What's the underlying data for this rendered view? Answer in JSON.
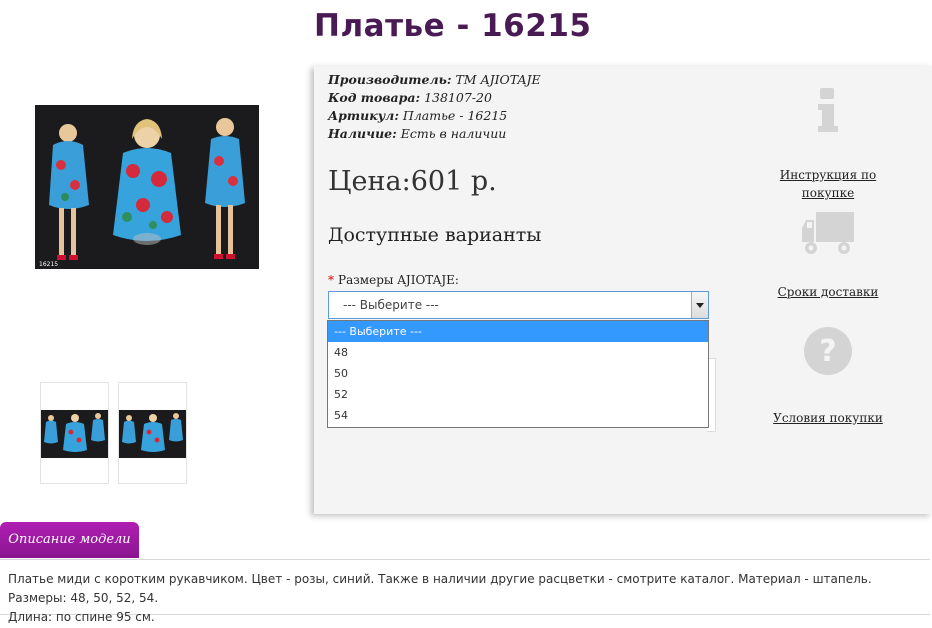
{
  "product": {
    "title": "Платье - 16215",
    "manufacturer_label": "Производитель:",
    "manufacturer_value": "TM AJIOTAJE",
    "code_label": "Код товара:",
    "code_value": "138107-20",
    "article_label": "Артикул:",
    "article_value": "Платье - 16215",
    "availability_label": "Наличие:",
    "availability_value": "Есть в наличии",
    "price": "Цена:601 р.",
    "image_code": "16215"
  },
  "options": {
    "title": "Доступные варианты",
    "required_mark": "*",
    "size_label": "Размеры AJIOTAJE:",
    "select_value": "--- Выберите ---",
    "dropdown_items": [
      "--- Выберите ---",
      "48",
      "50",
      "52",
      "54"
    ]
  },
  "sidebar": {
    "instruction_link": "Инструкция по покупке",
    "delivery_link": "Сроки доставки",
    "conditions_link": "Условия покупки",
    "question_mark": "?"
  },
  "description": {
    "tab_label": "Описание модели",
    "line1": "Платье миди с коротким рукавчиком. Цвет - розы, синий. Также в наличии другие расцветки - смотрите каталог. Материал - штапель. Размеры: 48, 50, 52, 54.",
    "line2": "Длина: по спине 95 см."
  },
  "colors": {
    "title": "#4a1a55",
    "tab": "#9b1aa0",
    "dropdown_highlight": "#3399ff",
    "icon_gray": "#d4d4d4"
  }
}
